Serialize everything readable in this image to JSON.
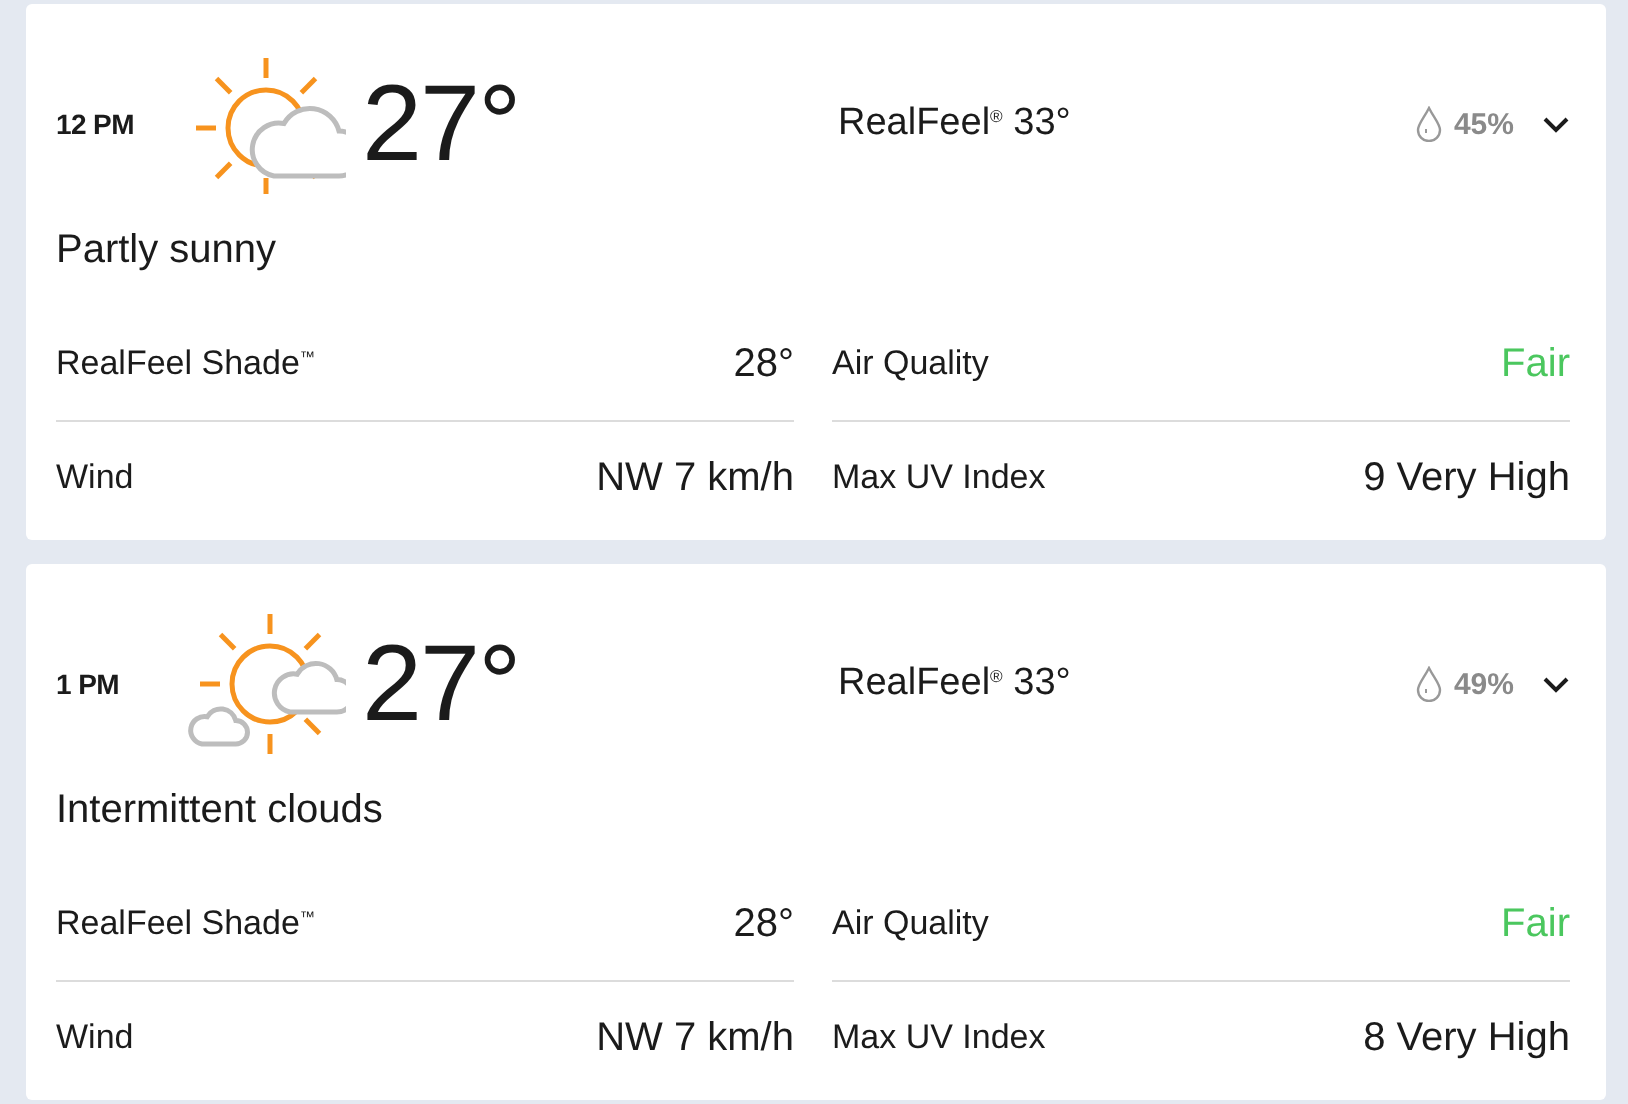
{
  "hours": [
    {
      "time": "12 PM",
      "icon": {
        "kind": "partly-sunny"
      },
      "temperature": "27°",
      "realfeel": "RealFeel$^{®}$ 33°",
      "precipitation": "45%",
      "expanded": false,
      "phrase": "Partly sunny",
      "details": [
        {
          "label": "RealFeel Shade$^{™}$",
          "value": "28°"
        },
        {
          "label": "Air Quality",
          "value": "Fair",
          "color": "#4bc75e"
        },
        {
          "label": "Wind",
          "value": "NW 7 km/h"
        },
        {
          "label": "Max UV Index",
          "value": "9 Very High"
        }
      ]
    },
    {
      "time": "1 PM",
      "icon": {
        "kind": "intermittent-clouds"
      },
      "temperature": "27°",
      "realfeel": "RealFeel$^{®}$ 33°",
      "precipitation": "49%",
      "expanded": false,
      "phrase": "Intermittent clouds",
      "details": [
        {
          "label": "RealFeel Shade$^{™}$",
          "value": "28°"
        },
        {
          "label": "Air Quality",
          "value": "Fair",
          "color": "#4bc75e"
        },
        {
          "label": "Wind",
          "value": "NW 7 km/h"
        },
        {
          "label": "Max UV Index",
          "value": "8 Very High"
        }
      ]
    }
  ]
}
